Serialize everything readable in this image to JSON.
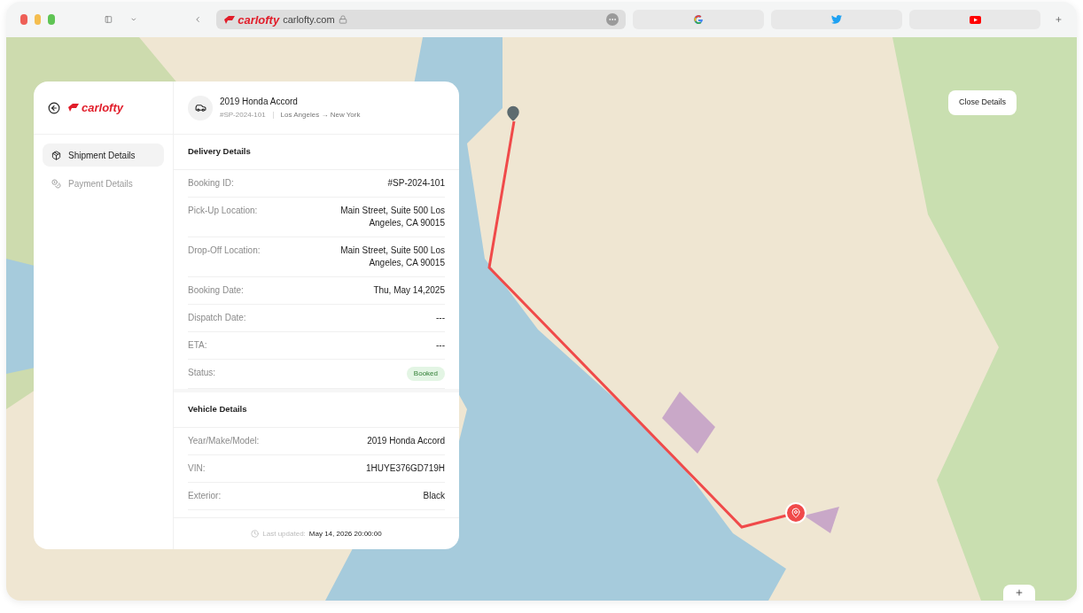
{
  "browser": {
    "tabs": [
      {
        "kind": "address",
        "brand": "carlofty",
        "url": "carlofty.com"
      },
      {
        "kind": "google"
      },
      {
        "kind": "twitter"
      },
      {
        "kind": "youtube"
      }
    ]
  },
  "panel": {
    "brand": "carlofty",
    "nav": [
      {
        "label": "Shipment Details",
        "kind": "shipment",
        "selected": true
      },
      {
        "label": "Payment Details",
        "kind": "payment",
        "selected": false
      }
    ],
    "vehicle": {
      "title": "2019 Honda Accord",
      "id": "#SP-2024-101",
      "from": "Los Angeles",
      "arrow": "→",
      "to": "New York"
    },
    "sections": [
      {
        "title": "Delivery Details",
        "rows": [
          {
            "label": "Booking ID:",
            "value": "#SP-2024-101",
            "kind": "text"
          },
          {
            "label": "Pick-Up Location:",
            "value": "Main Street, Suite 500 Los Angeles, CA 90015",
            "kind": "text"
          },
          {
            "label": "Drop-Off Location:",
            "value": "Main Street, Suite 500 Los Angeles, CA 90015",
            "kind": "text"
          },
          {
            "label": "Booking Date:",
            "value": "Thu, May 14,2025",
            "kind": "text"
          },
          {
            "label": "Dispatch Date:",
            "value": "---",
            "kind": "text"
          },
          {
            "label": "ETA:",
            "value": "---",
            "kind": "text"
          },
          {
            "label": "Status:",
            "value": "Booked",
            "kind": "badge"
          }
        ]
      },
      {
        "title": "Vehicle Details",
        "rows": [
          {
            "label": "Year/Make/Model:",
            "value": "2019 Honda Accord",
            "kind": "text"
          },
          {
            "label": "VIN:",
            "value": "1HUYE376GD719H",
            "kind": "text"
          },
          {
            "label": "Exterior:",
            "value": "Black",
            "kind": "text"
          }
        ]
      }
    ],
    "footer": {
      "label": "Last updated:",
      "value": "May 14, 2026 20:00:00"
    }
  },
  "map": {
    "close_button": "Close Details"
  }
}
